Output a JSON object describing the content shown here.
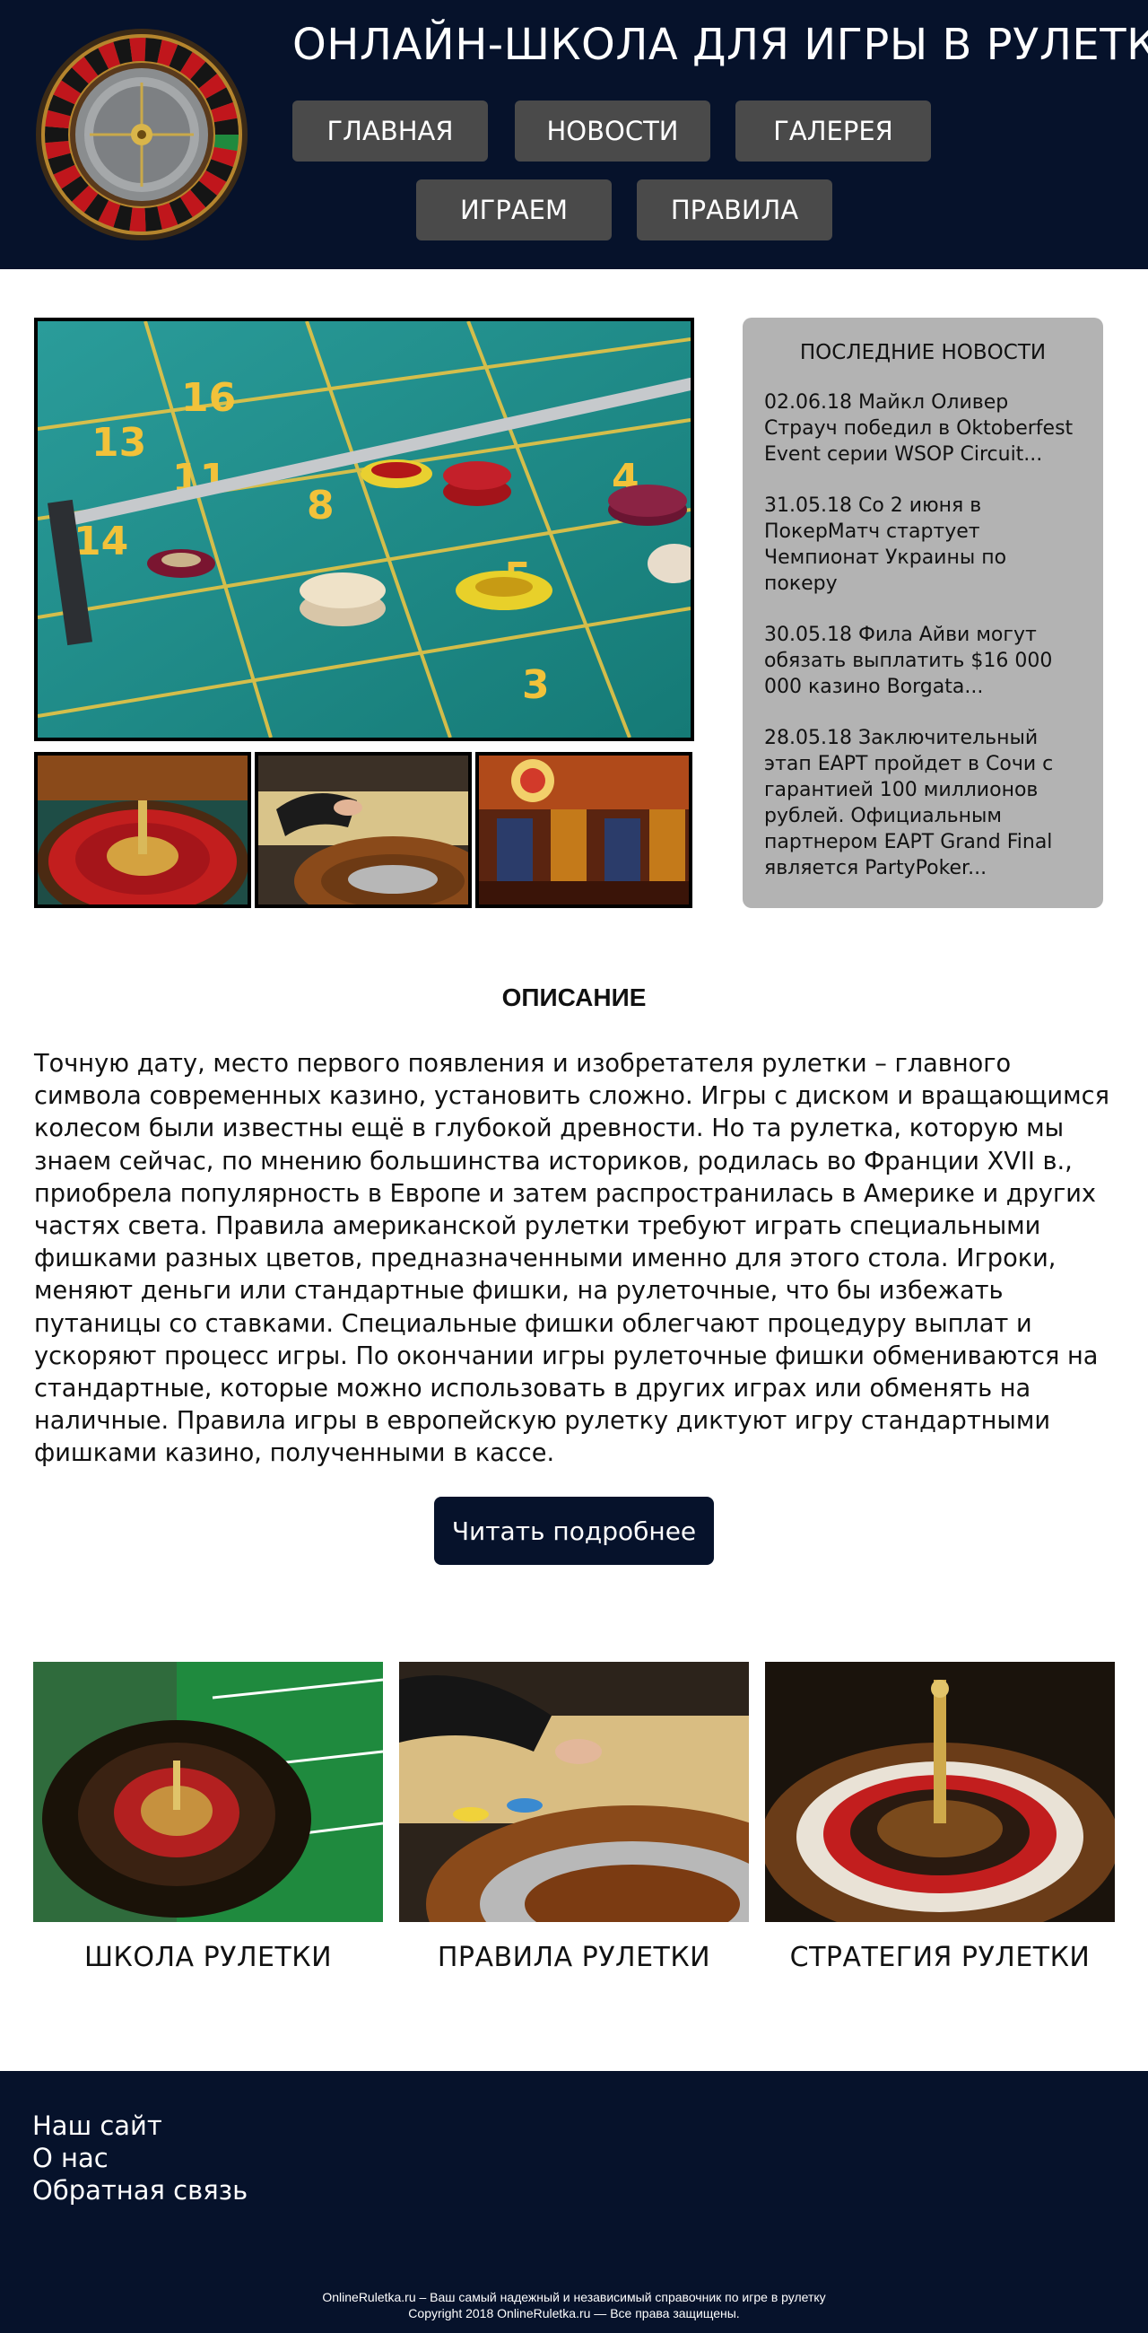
{
  "header": {
    "title": "ОНЛАЙН-ШКОЛА ДЛЯ ИГРЫ В РУЛЕТКУ",
    "nav": [
      {
        "label": "ГЛАВНАЯ"
      },
      {
        "label": "НОВОСТИ"
      },
      {
        "label": "ГАЛЕРЕЯ"
      },
      {
        "label": "ИГРАЕМ"
      },
      {
        "label": "ПРАВИЛА"
      }
    ]
  },
  "news": {
    "title": "ПОСЛЕДНИЕ НОВОСТИ",
    "items": [
      {
        "text": "02.06.18 Майкл Оливер Страуч победил в Oktoberfest Event серии WSOP Circuit..."
      },
      {
        "text": "31.05.18 Со 2 июня в ПокерМатч стартует Чемпионат Украины по покеру"
      },
      {
        "text": "30.05.18 Фила Айви могут обязать выплатить $16 000 000 казино Borgata..."
      },
      {
        "text": "28.05.18 Заключительный этап EAPT пройдет в Сочи с гарантией 100 миллионов рублей. Официальным партнером EAPT Grand Final является PartyPoker..."
      }
    ]
  },
  "description": {
    "title": "ОПИСАНИЕ",
    "text": "Точную дату, место первого появления и изобретателя рулетки – главного символа современных казино, установить сложно. Игры с диском и вращающимся колесом были известны ещё в глубокой древности. Но та рулетка, которую мы знаем сейчас, по мнению большинства историков, родилась во Франции XVII в., приобрела популярность в Европе и затем распространилась в Америке и других частях света. Правила американской рулетки требуют играть специальными фишками разных цветов, предназначенными именно для этого стола. Игроки, меняют деньги или стандартные фишки, на рулеточные, что бы избежать путаницы со ставками. Специальные фишки облегчают процедуру выплат и ускоряют процесс игры. По окончании игры рулеточные фишки обмениваются на стандартные, которые можно использовать в других играх или обменять на наличные. Правила игры в европейскую рулетку диктуют игру стандартными фишками казино, полученными в кассе.",
    "button": "Читать подробнее"
  },
  "cards": [
    {
      "label": "ШКОЛА РУЛЕТКИ"
    },
    {
      "label": "ПРАВИЛА РУЛЕТКИ"
    },
    {
      "label": "СТРАТЕГИЯ РУЛЕТКИ"
    }
  ],
  "footer": {
    "links": [
      "Наш сайт",
      "О нас",
      "Обратная связь"
    ],
    "note_line1": "OnlineRuletka.ru – Ваш самый надежный и независимый справочник по игре в рулетку",
    "note_line2": "Copyright 2018 OnlineRuletka.ru — Все права защищены."
  },
  "table_numbers": [
    "13",
    "14",
    "8",
    "5",
    "4",
    "3",
    "16",
    "11"
  ],
  "colors": {
    "header_bg": "#06122b",
    "nav_button": "#4a4a4a",
    "news_bg": "#b3b3b3",
    "felt": "#1d8a88",
    "accent_gold": "#e8b422",
    "roulette_red": "#c0161c"
  }
}
